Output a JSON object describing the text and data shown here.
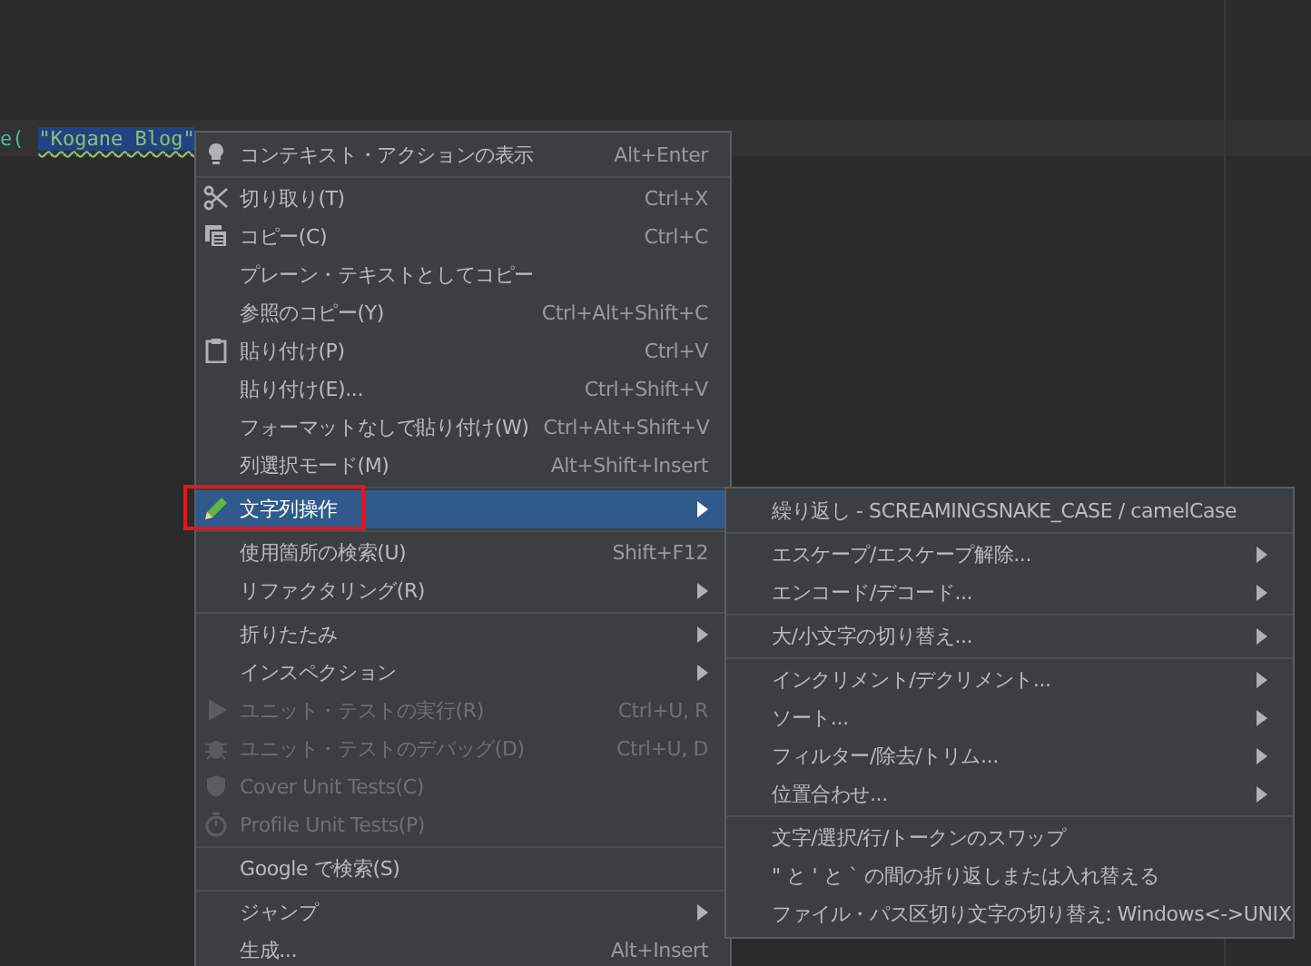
{
  "editor": {
    "code_tokens": [
      {
        "text": "e(",
        "kind": "call",
        "selected": false
      },
      {
        "text": "\"Kogane Blog\"",
        "kind": "string",
        "selected": true
      }
    ]
  },
  "context_menu": {
    "groups": [
      [
        {
          "label": "コンテキスト・アクションの表示",
          "shortcut": "Alt+Enter",
          "kind": "bulb",
          "disabled": false,
          "selected": false,
          "submenu": false
        }
      ],
      [
        {
          "label": "切り取り(T)",
          "shortcut": "Ctrl+X",
          "kind": "scissors",
          "disabled": false,
          "selected": false,
          "submenu": false
        },
        {
          "label": "コピー(C)",
          "shortcut": "Ctrl+C",
          "kind": "copy",
          "disabled": false,
          "selected": false,
          "submenu": false
        },
        {
          "label": "プレーン・テキストとしてコピー",
          "disabled": false,
          "selected": false,
          "submenu": false
        },
        {
          "label": "参照のコピー(Y)",
          "shortcut": "Ctrl+Alt+Shift+C",
          "disabled": false,
          "selected": false,
          "submenu": false
        },
        {
          "label": "貼り付け(P)",
          "shortcut": "Ctrl+V",
          "kind": "clipboard",
          "disabled": false,
          "selected": false,
          "submenu": false
        },
        {
          "label": "貼り付け(E)...",
          "shortcut": "Ctrl+Shift+V",
          "disabled": false,
          "selected": false,
          "submenu": false
        },
        {
          "label": "フォーマットなしで貼り付け(W)",
          "shortcut": "Ctrl+Alt+Shift+V",
          "disabled": false,
          "selected": false,
          "submenu": false
        },
        {
          "label": "列選択モード(M)",
          "shortcut": "Alt+Shift+Insert",
          "disabled": false,
          "selected": false,
          "submenu": false
        }
      ],
      [
        {
          "label": "文字列操作",
          "kind": "pencil",
          "disabled": false,
          "selected": true,
          "submenu": true,
          "annotated": true
        }
      ],
      [
        {
          "label": "使用箇所の検索(U)",
          "shortcut": "Shift+F12",
          "disabled": false,
          "selected": false,
          "submenu": false
        },
        {
          "label": "リファクタリング(R)",
          "disabled": false,
          "selected": false,
          "submenu": true
        }
      ],
      [
        {
          "label": "折りたたみ",
          "disabled": false,
          "selected": false,
          "submenu": true
        },
        {
          "label": "インスペクション",
          "disabled": false,
          "selected": false,
          "submenu": true
        },
        {
          "label": "ユニット・テストの実行(R)",
          "shortcut": "Ctrl+U, R",
          "kind": "play",
          "disabled": true,
          "selected": false,
          "submenu": false
        },
        {
          "label": "ユニット・テストのデバッグ(D)",
          "shortcut": "Ctrl+U, D",
          "kind": "bug",
          "disabled": true,
          "selected": false,
          "submenu": false
        },
        {
          "label": "Cover Unit Tests(C)",
          "kind": "shield",
          "disabled": true,
          "selected": false,
          "submenu": false
        },
        {
          "label": "Profile Unit Tests(P)",
          "kind": "stopwatch",
          "disabled": true,
          "selected": false,
          "submenu": false
        }
      ],
      [
        {
          "label": "Google で検索(S)",
          "disabled": false,
          "selected": false,
          "submenu": false
        }
      ],
      [
        {
          "label": "ジャンプ",
          "disabled": false,
          "selected": false,
          "submenu": true
        },
        {
          "label": "生成...",
          "shortcut": "Alt+Insert",
          "disabled": false,
          "selected": false,
          "submenu": false
        }
      ]
    ]
  },
  "submenu": {
    "groups": [
      [
        {
          "label": "繰り返し - SCREAMINGSNAKE_CASE / camelCase",
          "disabled": false,
          "selected": false,
          "submenu": false
        }
      ],
      [
        {
          "label": "エスケープ/エスケープ解除...",
          "disabled": false,
          "selected": false,
          "submenu": true
        },
        {
          "label": "エンコード/デコード...",
          "disabled": false,
          "selected": false,
          "submenu": true
        }
      ],
      [
        {
          "label": "大/小文字の切り替え...",
          "disabled": false,
          "selected": false,
          "submenu": true
        }
      ],
      [
        {
          "label": "インクリメント/デクリメント...",
          "disabled": false,
          "selected": false,
          "submenu": true
        },
        {
          "label": "ソート...",
          "disabled": false,
          "selected": false,
          "submenu": true
        },
        {
          "label": "フィルター/除去/トリム...",
          "disabled": false,
          "selected": false,
          "submenu": true
        },
        {
          "label": "位置合わせ...",
          "disabled": false,
          "selected": false,
          "submenu": true
        }
      ],
      [
        {
          "label": "文字/選択/行/トークンのスワップ",
          "disabled": false,
          "selected": false,
          "submenu": false
        },
        {
          "label": "\" と ' と ` の間の折り返しまたは入れ替える",
          "disabled": false,
          "selected": false,
          "submenu": false
        },
        {
          "label": "ファイル・パス区切り文字の切り替え: Windows<->UNIX",
          "disabled": false,
          "selected": false,
          "submenu": false
        }
      ]
    ]
  }
}
